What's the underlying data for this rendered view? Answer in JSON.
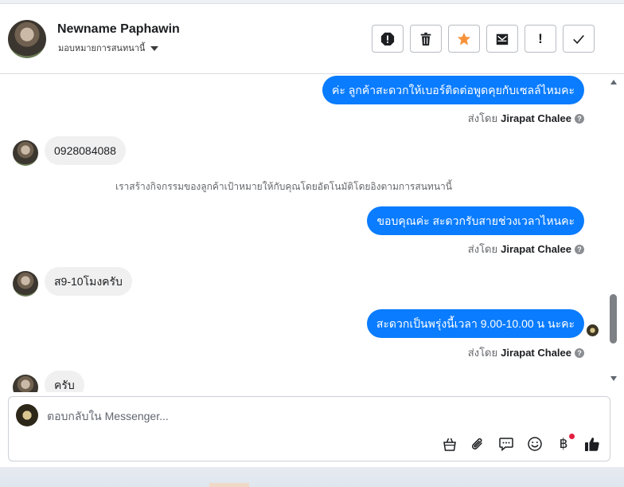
{
  "header": {
    "name": "Newname Paphawin",
    "assign_label": "มอบหมายการสนทนานี้",
    "toolbar": [
      {
        "name": "report-icon",
        "label": ""
      },
      {
        "name": "trash-icon",
        "label": ""
      },
      {
        "name": "star-icon",
        "label": ""
      },
      {
        "name": "mark-unread-icon",
        "label": ""
      },
      {
        "name": "important-icon",
        "label": "!"
      },
      {
        "name": "check-icon",
        "label": ""
      }
    ]
  },
  "colors": {
    "outgoing_bubble": "#0a7cff",
    "incoming_bubble": "#f0f0f0",
    "star": "#f7923a",
    "notification_dot": "#e41e3f"
  },
  "messages": [
    {
      "type": "outgoing",
      "text": "ค่ะ ลูกค้าสะดวกให้เบอร์ติดต่อพูดคุยกับเซลล์ไหมคะ",
      "sent_by_prefix": "ส่งโดย",
      "sent_by": "Jirapat Chalee"
    },
    {
      "type": "incoming",
      "text": "0928084088"
    },
    {
      "type": "system",
      "text": "เราสร้างกิจกรรมของลูกค้าเป้าหมายให้กับคุณโดยอัตโนมัติโดยอิงตามการสนทนานี้"
    },
    {
      "type": "outgoing",
      "text": "ขอบคุณค่ะ สะดวกรับสายช่วงเวลาไหนคะ",
      "sent_by_prefix": "ส่งโดย",
      "sent_by": "Jirapat Chalee"
    },
    {
      "type": "incoming",
      "text": "ส9-10โมงครับ"
    },
    {
      "type": "outgoing",
      "text": "สะดวกเป็นพรุ่งนี้เวลา 9.00-10.00 น นะคะ",
      "sent_by_prefix": "ส่งโดย",
      "sent_by": "Jirapat Chalee"
    },
    {
      "type": "incoming",
      "text": "ครับ"
    }
  ],
  "composer": {
    "placeholder": "ตอบกลับใน Messenger...",
    "icons": [
      "shop-icon",
      "attachment-icon",
      "saved-replies-icon",
      "emoji-icon",
      "baht-icon",
      "like-icon"
    ],
    "baht_symbol": "฿"
  }
}
